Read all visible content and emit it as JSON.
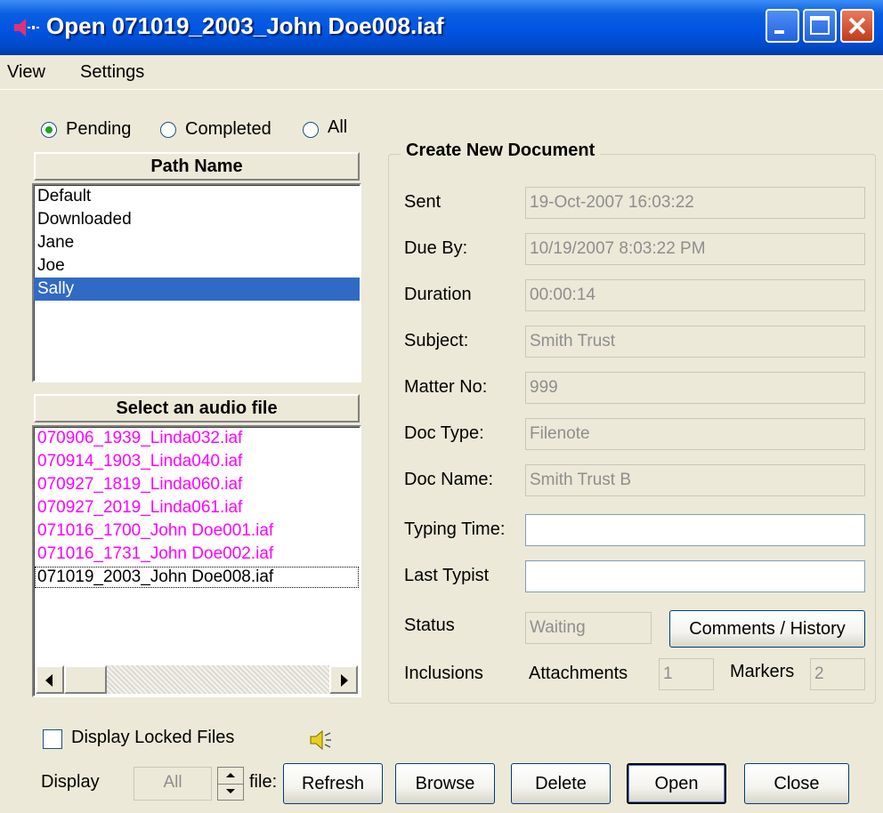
{
  "window": {
    "title": "Open 071019_2003_John Doe008.iaf",
    "colors": {
      "titlebar": "#0054e3",
      "selection": "#316ac5",
      "pending_file": "#ff00ff"
    }
  },
  "menu": {
    "view": "View",
    "settings": "Settings"
  },
  "filter": {
    "pending": "Pending",
    "completed": "Completed",
    "all": "All",
    "selected": "Pending"
  },
  "paths": {
    "header": "Path Name",
    "items": [
      "Default",
      "Downloaded",
      "Jane",
      "Joe",
      "Sally"
    ],
    "selected": "Sally"
  },
  "files": {
    "header": "Select an audio file",
    "items": [
      "070906_1939_Linda032.iaf",
      "070914_1903_Linda040.iaf",
      "070927_1819_Linda060.iaf",
      "070927_2019_Linda061.iaf",
      "071016_1700_John Doe001.iaf",
      "071016_1731_John Doe002.iaf",
      "071019_2003_John Doe008.iaf"
    ],
    "focused": "071019_2003_John Doe008.iaf"
  },
  "doc": {
    "group_label": "Create New Document",
    "sent_label": "Sent",
    "sent": "19-Oct-2007 16:03:22",
    "due_label": "Due By:",
    "due": "10/19/2007 8:03:22 PM",
    "duration_label": "Duration",
    "duration": "00:00:14",
    "subject_label": "Subject:",
    "subject": "Smith Trust",
    "matter_label": "Matter No:",
    "matter": "999",
    "doctype_label": "Doc Type:",
    "doctype": "Filenote",
    "docname_label": "Doc Name:",
    "docname": "Smith Trust B",
    "typing_label": "Typing Time:",
    "typing": "",
    "typist_label": "Last Typist",
    "typist": "",
    "status_label": "Status",
    "status": "Waiting",
    "comments_button": "Comments / History",
    "inclusions_label": "Inclusions",
    "attachments_label": "Attachments",
    "attachments": "1",
    "markers_label": "Markers",
    "markers": "2"
  },
  "bottom": {
    "locked_label": "Display Locked Files",
    "locked_checked": false,
    "speaker_icon": "speaker-icon",
    "display_label": "Display",
    "display_value": "All",
    "files_label": "file:",
    "buttons": {
      "refresh": "Refresh",
      "browse": "Browse",
      "delete": "Delete",
      "open": "Open",
      "close": "Close"
    }
  }
}
